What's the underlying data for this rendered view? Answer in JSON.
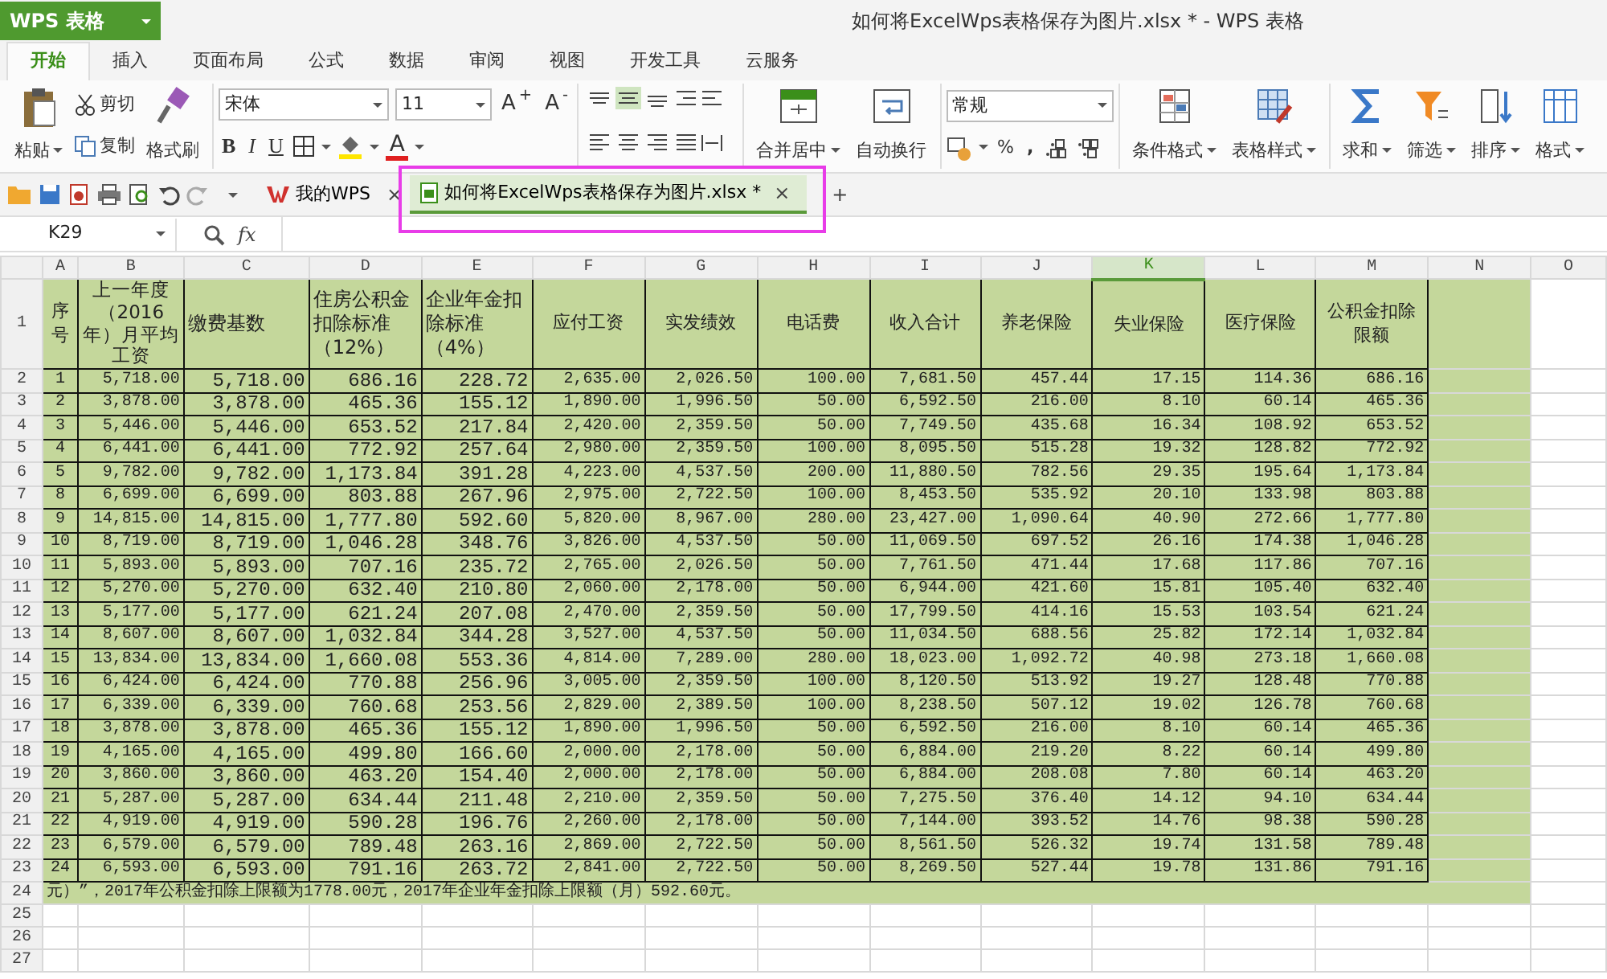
{
  "title_bar": {
    "app_menu": "WPS 表格",
    "title": "如何将ExcelWps表格保存为图片.xlsx * - WPS 表格"
  },
  "ribbon_tabs": [
    {
      "label": "开始",
      "selected": true
    },
    {
      "label": "插入",
      "selected": false
    },
    {
      "label": "页面布局",
      "selected": false
    },
    {
      "label": "公式",
      "selected": false
    },
    {
      "label": "数据",
      "selected": false
    },
    {
      "label": "审阅",
      "selected": false
    },
    {
      "label": "视图",
      "selected": false
    },
    {
      "label": "开发工具",
      "selected": false
    },
    {
      "label": "云服务",
      "selected": false
    }
  ],
  "ribbon": {
    "paste": "粘贴",
    "cut": "剪切",
    "copy": "复制",
    "format_painter": "格式刷",
    "font_name": "宋体",
    "font_size": "11",
    "grow_font": "A$^{+}$",
    "shrink_font": "A$^{-}$",
    "bold": "B",
    "italic": "I",
    "underline": "U",
    "font_color": "A",
    "merge_center": "合并居中",
    "wrap_text": "自动换行",
    "number_format": "常规",
    "percent": "%",
    "comma": ",",
    "conditional_format": "条件格式",
    "table_style": "表格样式",
    "sum": "求和",
    "filter": "筛选",
    "sort": "排序",
    "format": "格式"
  },
  "document_tabs": [
    {
      "label": "我的WPS",
      "selected": false,
      "close": "×"
    },
    {
      "label": "如何将ExcelWps表格保存为图片.xlsx *",
      "selected": true,
      "close": "×"
    }
  ],
  "new_tab": "+",
  "formula_bar": {
    "name_box": "K29",
    "fx": "fx"
  },
  "sheet": {
    "columns": [
      {
        "label": "A",
        "selected": false
      },
      {
        "label": "B",
        "selected": false
      },
      {
        "label": "C",
        "selected": false
      },
      {
        "label": "D",
        "selected": false
      },
      {
        "label": "E",
        "selected": false
      },
      {
        "label": "F",
        "selected": false
      },
      {
        "label": "G",
        "selected": false
      },
      {
        "label": "H",
        "selected": false
      },
      {
        "label": "I",
        "selected": false
      },
      {
        "label": "J",
        "selected": false
      },
      {
        "label": "K",
        "selected": true
      },
      {
        "label": "L",
        "selected": false
      },
      {
        "label": "M",
        "selected": false
      },
      {
        "label": "N",
        "selected": false
      },
      {
        "label": "O",
        "selected": false
      }
    ],
    "row_numbers": [
      "1",
      "2",
      "3",
      "4",
      "5",
      "6",
      "7",
      "8",
      "9",
      "10",
      "11",
      "12",
      "13",
      "14",
      "15",
      "16",
      "17",
      "18",
      "19",
      "20",
      "21",
      "22",
      "23",
      "24",
      "25",
      "26",
      "27"
    ],
    "header_row": [
      "序号",
      "上一年度（2016年）月平均工资",
      "缴费基数",
      "住房公积金扣除标准（12%）",
      "企业年金扣除标准（4%）",
      "应付工资",
      "实发绩效",
      "电话费",
      "收入合计",
      "养老保险",
      "失业保险",
      "医疗保险",
      "公积金扣除限额"
    ],
    "rows": [
      [
        "1",
        "5,718.00",
        "5,718.00",
        "686.16",
        "228.72",
        "2,635.00",
        "2,026.50",
        "100.00",
        "7,681.50",
        "457.44",
        "17.15",
        "114.36",
        "686.16"
      ],
      [
        "2",
        "3,878.00",
        "3,878.00",
        "465.36",
        "155.12",
        "1,890.00",
        "1,996.50",
        "50.00",
        "6,592.50",
        "216.00",
        "8.10",
        "60.14",
        "465.36"
      ],
      [
        "3",
        "5,446.00",
        "5,446.00",
        "653.52",
        "217.84",
        "2,420.00",
        "2,359.50",
        "50.00",
        "7,749.50",
        "435.68",
        "16.34",
        "108.92",
        "653.52"
      ],
      [
        "4",
        "6,441.00",
        "6,441.00",
        "772.92",
        "257.64",
        "2,980.00",
        "2,359.50",
        "100.00",
        "8,095.50",
        "515.28",
        "19.32",
        "128.82",
        "772.92"
      ],
      [
        "5",
        "9,782.00",
        "9,782.00",
        "1,173.84",
        "391.28",
        "4,223.00",
        "4,537.50",
        "200.00",
        "11,880.50",
        "782.56",
        "29.35",
        "195.64",
        "1,173.84"
      ],
      [
        "8",
        "6,699.00",
        "6,699.00",
        "803.88",
        "267.96",
        "2,975.00",
        "2,722.50",
        "100.00",
        "8,453.50",
        "535.92",
        "20.10",
        "133.98",
        "803.88"
      ],
      [
        "9",
        "14,815.00",
        "14,815.00",
        "1,777.80",
        "592.60",
        "5,820.00",
        "8,967.00",
        "280.00",
        "23,427.00",
        "1,090.64",
        "40.90",
        "272.66",
        "1,777.80"
      ],
      [
        "10",
        "8,719.00",
        "8,719.00",
        "1,046.28",
        "348.76",
        "3,826.00",
        "4,537.50",
        "50.00",
        "11,069.50",
        "697.52",
        "26.16",
        "174.38",
        "1,046.28"
      ],
      [
        "11",
        "5,893.00",
        "5,893.00",
        "707.16",
        "235.72",
        "2,765.00",
        "2,026.50",
        "50.00",
        "7,761.50",
        "471.44",
        "17.68",
        "117.86",
        "707.16"
      ],
      [
        "12",
        "5,270.00",
        "5,270.00",
        "632.40",
        "210.80",
        "2,060.00",
        "2,178.00",
        "50.00",
        "6,944.00",
        "421.60",
        "15.81",
        "105.40",
        "632.40"
      ],
      [
        "13",
        "5,177.00",
        "5,177.00",
        "621.24",
        "207.08",
        "2,470.00",
        "2,359.50",
        "50.00",
        "17,799.50",
        "414.16",
        "15.53",
        "103.54",
        "621.24"
      ],
      [
        "14",
        "8,607.00",
        "8,607.00",
        "1,032.84",
        "344.28",
        "3,527.00",
        "4,537.50",
        "50.00",
        "11,034.50",
        "688.56",
        "25.82",
        "172.14",
        "1,032.84"
      ],
      [
        "15",
        "13,834.00",
        "13,834.00",
        "1,660.08",
        "553.36",
        "4,814.00",
        "7,289.00",
        "280.00",
        "18,023.00",
        "1,092.72",
        "40.98",
        "273.18",
        "1,660.08"
      ],
      [
        "16",
        "6,424.00",
        "6,424.00",
        "770.88",
        "256.96",
        "3,005.00",
        "2,359.50",
        "100.00",
        "8,120.50",
        "513.92",
        "19.27",
        "128.48",
        "770.88"
      ],
      [
        "17",
        "6,339.00",
        "6,339.00",
        "760.68",
        "253.56",
        "2,829.00",
        "2,389.50",
        "100.00",
        "8,238.50",
        "507.12",
        "19.02",
        "126.78",
        "760.68"
      ],
      [
        "18",
        "3,878.00",
        "3,878.00",
        "465.36",
        "155.12",
        "1,890.00",
        "1,996.50",
        "50.00",
        "6,592.50",
        "216.00",
        "8.10",
        "60.14",
        "465.36"
      ],
      [
        "19",
        "4,165.00",
        "4,165.00",
        "499.80",
        "166.60",
        "2,000.00",
        "2,178.00",
        "50.00",
        "6,884.00",
        "219.20",
        "8.22",
        "60.14",
        "499.80"
      ],
      [
        "20",
        "3,860.00",
        "3,860.00",
        "463.20",
        "154.40",
        "2,000.00",
        "2,178.00",
        "50.00",
        "6,884.00",
        "208.08",
        "7.80",
        "60.14",
        "463.20"
      ],
      [
        "21",
        "5,287.00",
        "5,287.00",
        "634.44",
        "211.48",
        "2,210.00",
        "2,359.50",
        "50.00",
        "7,275.50",
        "376.40",
        "14.12",
        "94.10",
        "634.44"
      ],
      [
        "22",
        "4,919.00",
        "4,919.00",
        "590.28",
        "196.76",
        "2,260.00",
        "2,178.00",
        "50.00",
        "7,144.00",
        "393.52",
        "14.76",
        "98.38",
        "590.28"
      ],
      [
        "23",
        "6,579.00",
        "6,579.00",
        "789.48",
        "263.16",
        "2,869.00",
        "2,722.50",
        "50.00",
        "8,561.50",
        "526.32",
        "19.74",
        "131.58",
        "789.48"
      ],
      [
        "24",
        "6,593.00",
        "6,593.00",
        "791.16",
        "263.72",
        "2,841.00",
        "2,722.50",
        "50.00",
        "8,269.50",
        "527.44",
        "19.78",
        "131.86",
        "791.16"
      ]
    ],
    "note": "元）”，2017年公积金扣除上限额为1778.00元，2017年企业年金扣除上限额（月）592.60元。"
  }
}
